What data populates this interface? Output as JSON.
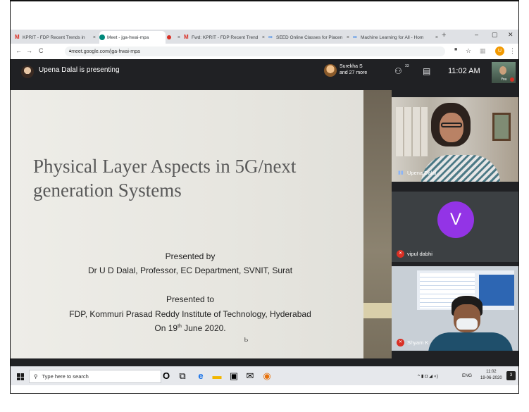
{
  "browser": {
    "tabs": [
      {
        "label": "KPRIT - FDP Recent Trends in",
        "icon": "gmail-icon",
        "active": false
      },
      {
        "label": "Meet - jga-hwai-mpa",
        "icon": "meet-icon",
        "active": true
      },
      {
        "label": "",
        "icon": "recording-dot-icon",
        "active": false
      },
      {
        "label": "Fwd: KPRIT - FDP Recent Trend",
        "icon": "gmail-icon",
        "active": false
      },
      {
        "label": "SEED Online Classes for Placen",
        "icon": "link-icon",
        "active": false
      },
      {
        "label": "Machine Learning for All - Hom",
        "icon": "link-icon",
        "active": false
      }
    ],
    "tab_close": "×",
    "new_tab": "+",
    "window_controls": {
      "minimize": "–",
      "maximize": "▢",
      "close": "✕"
    },
    "nav": {
      "back": "←",
      "forward": "→",
      "reload": "C"
    },
    "url": "meet.google.com/jga-hwai-mpa",
    "profile_initial": "U"
  },
  "meet": {
    "presenting_text": "Upena Dalal is presenting",
    "participants_line1": "Surekha S",
    "participants_line2": "and 27 more",
    "people_count": "33",
    "time": "11:02 AM",
    "self_label": "You"
  },
  "slide": {
    "title_line1": "Physical Layer Aspects in 5G/next",
    "title_line2": "generation Systems",
    "presented_by_label": "Presented by",
    "presenter": "Dr U D Dalal, Professor, EC Department, SVNIT, Surat",
    "presented_to_label": "Presented to",
    "audience": "FDP, Kommuri Prasad Reddy Institute of Technology, Hyderabad",
    "date_prefix": "On 19",
    "date_suffix": "th",
    "date_rest": " June 2020.",
    "cursor_glyph": "Ꮟ"
  },
  "tiles": [
    {
      "name": "Upena Dalal",
      "muted": false
    },
    {
      "name": "vipul dabhi",
      "muted": true,
      "avatar_letter": "V",
      "avatar_color": "#9334e6"
    },
    {
      "name": "Shyam K",
      "muted": true
    }
  ],
  "taskbar": {
    "search_placeholder": "Type here to search",
    "lang": "ENG",
    "time": "11:02",
    "date": "19-06-2020",
    "notification_count": "3",
    "tray_icons": "^ ▮ ◘ ◢ ◖)"
  },
  "colors": {
    "meet_dark": "#202124",
    "accent_purple": "#9334e6",
    "mute_red": "#d93025"
  }
}
